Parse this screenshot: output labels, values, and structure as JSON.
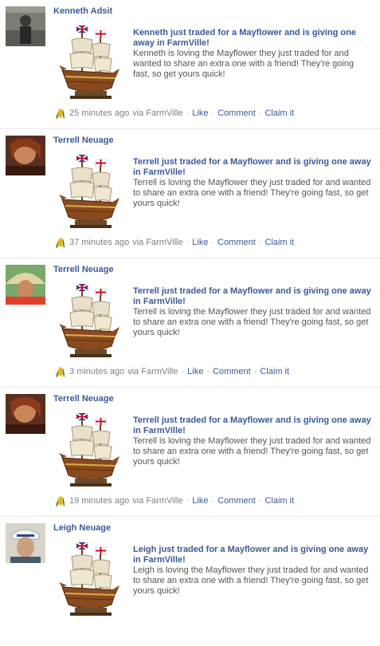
{
  "stories": [
    {
      "actor": "Kenneth Adsit",
      "title": "Kenneth just traded for a Mayflower and is giving one away in FarmVille!",
      "description": "Kenneth is loving the Mayflower they just traded for and wanted to share an extra one with a friend! They're going fast, so get yours quick!",
      "time": "25 minutes ago",
      "via": "via FarmVille",
      "like": "Like",
      "comment": "Comment",
      "claim": "Claim it"
    },
    {
      "actor": "Terrell Neuage",
      "title": "Terrell just traded for a Mayflower and is giving one away in FarmVille!",
      "description": "Terrell is loving the Mayflower they just traded for and wanted to share an extra one with a friend! They're going fast, so get yours quick!",
      "time": "37 minutes ago",
      "via": "via FarmVille",
      "like": "Like",
      "comment": "Comment",
      "claim": "Claim it"
    },
    {
      "actor": "Terrell Neuage",
      "title": "Terrell just traded for a Mayflower and is giving one away in FarmVille!",
      "description": "Terrell is loving the Mayflower they just traded for and wanted to share an extra one with a friend! They're going fast, so get yours quick!",
      "time": "3 minutes ago",
      "via": "via FarmVille",
      "like": "Like",
      "comment": "Comment",
      "claim": "Claim it"
    },
    {
      "actor": "Terrell Neuage",
      "title": "Terrell just traded for a Mayflower and is giving one away in FarmVille!",
      "description": "Terrell is loving the Mayflower they just traded for and wanted to share an extra one with a friend! They're going fast, so get yours quick!",
      "time": "19 minutes ago",
      "via": "via FarmVille",
      "like": "Like",
      "comment": "Comment",
      "claim": "Claim it"
    },
    {
      "actor": "Leigh Neuage",
      "title": "Leigh just traded for a Mayflower and is giving one away in FarmVille!",
      "description": "Leigh is loving the Mayflower they just traded for and wanted to share an extra one with a friend! They're going fast, so get yours quick!",
      "time": "",
      "via": "",
      "like": "",
      "comment": "",
      "claim": ""
    }
  ],
  "icons": {
    "app": "farmville-corn-icon",
    "thumbnail": "mayflower-ship-icon"
  },
  "colors": {
    "link": "#3b5998",
    "meta": "#808080",
    "divider": "#e9e9e9"
  }
}
